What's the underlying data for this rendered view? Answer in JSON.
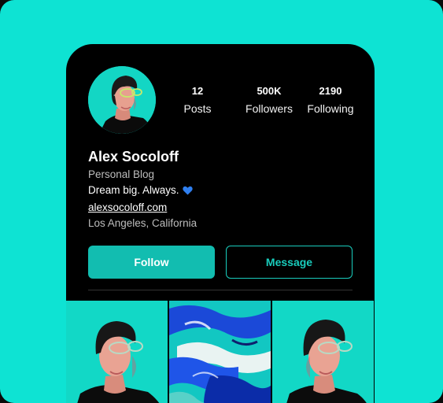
{
  "profile": {
    "name": "Alex Socoloff",
    "category": "Personal Blog",
    "tagline": "Dream big. Always.",
    "website": "alexsocoloff.com",
    "location": "Los Angeles, California"
  },
  "stats": [
    {
      "value": "12",
      "label": "Posts"
    },
    {
      "value": "500K",
      "label": "Followers"
    },
    {
      "value": "2190",
      "label": "Following"
    }
  ],
  "actions": {
    "follow_label": "Follow",
    "message_label": "Message"
  },
  "colors": {
    "background": "#0ee3d3",
    "accent": "#12bdb0",
    "card": "#000000",
    "heart": "#2f7ff0"
  },
  "icons": {
    "tagline_emoji": "blue-heart-icon"
  }
}
